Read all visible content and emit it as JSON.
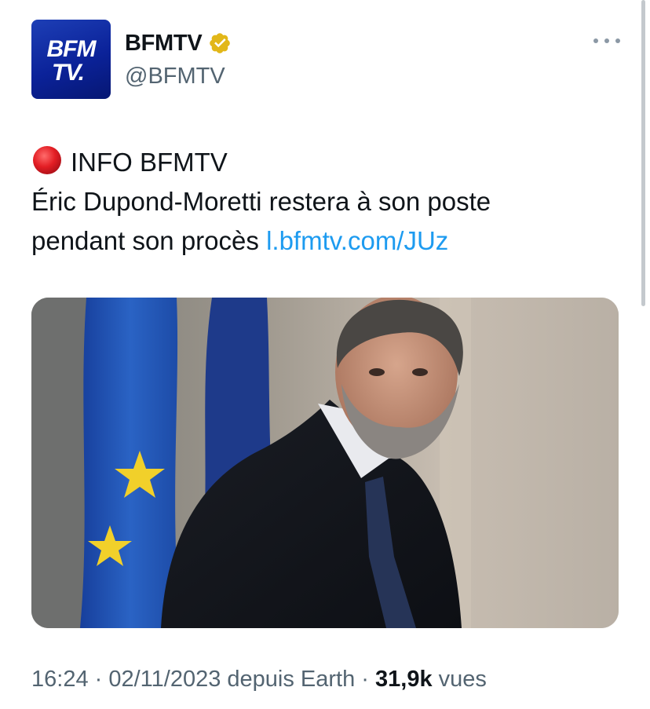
{
  "author": {
    "avatar_line1": "BFM",
    "avatar_line2": "TV.",
    "display_name": "BFMTV",
    "handle": "@BFMTV",
    "verified_color": "#E2B719"
  },
  "tweet": {
    "lead_icon": "red-circle-icon",
    "line1": "INFO BFMTV",
    "line2": "Éric Dupond-Moretti restera à son poste",
    "line3": "pendant son procès",
    "link": "l.bfmtv.com/JUz"
  },
  "media": {
    "alt_icon": "photo"
  },
  "meta": {
    "time": "16:24",
    "sep1": " · ",
    "date": "02/11/2023",
    "source": " depuis Earth",
    "sep2": " · ",
    "views_count": "31,9k",
    "views_label": " vues"
  },
  "colors": {
    "link": "#1D9BF0",
    "secondary_text": "#536471",
    "brand_blue": "#0B2299"
  }
}
